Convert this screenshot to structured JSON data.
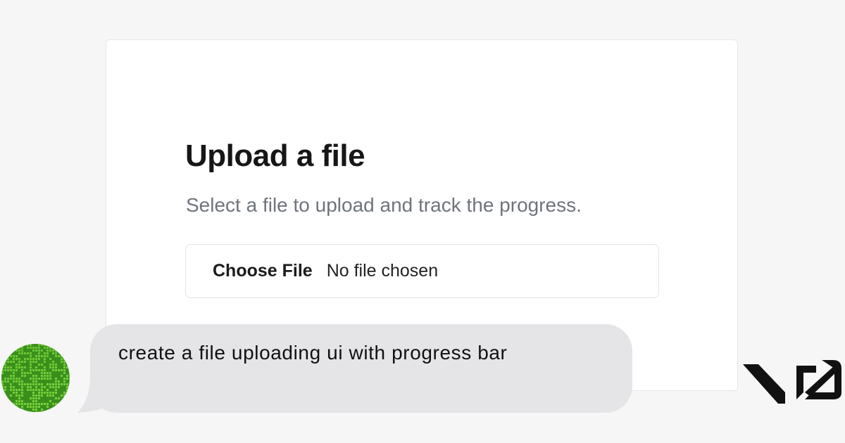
{
  "upload_card": {
    "title": "Upload a file",
    "subtitle": "Select a file to upload and track the progress.",
    "file_input": {
      "button_label": "Choose File",
      "status": "No file chosen"
    }
  },
  "chat": {
    "message": "create a file uploading ui with progress bar"
  },
  "avatar": {
    "icon": "pixel-gradient-avatar",
    "colors": [
      "#3a8f1c",
      "#8fe060"
    ]
  },
  "logo": {
    "icon": "v0-logo",
    "color": "#111111"
  },
  "colors": {
    "page_background": "#f6f6f6",
    "card_background": "#ffffff",
    "bubble_background": "#e5e5e8",
    "subtitle_text": "#6f747c"
  }
}
